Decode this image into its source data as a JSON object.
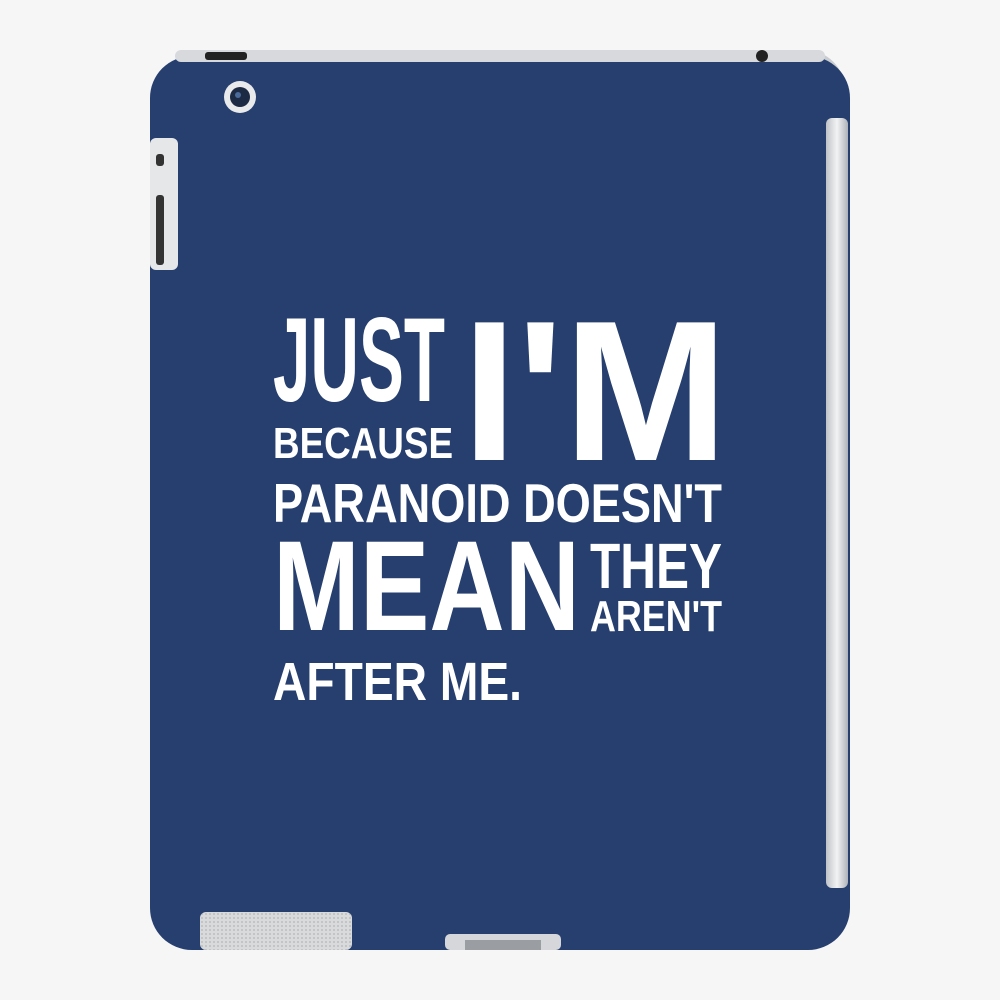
{
  "product": {
    "case_color": "#263f6e",
    "text_color": "#ffffff",
    "background_color": "#f6f6f6"
  },
  "slogan": {
    "just": "JUST",
    "because": "BECAUSE",
    "im": "I'M",
    "paranoid_doesnt": "PARANOID DOESN'T",
    "mean": "MEAN",
    "they": "THEY",
    "arent": "AREN'T",
    "after_me": "AFTER ME."
  }
}
